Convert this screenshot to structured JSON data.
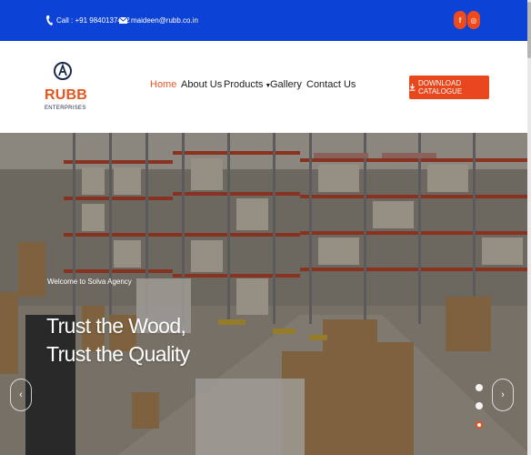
{
  "topbar": {
    "phone": "Call : +91 9840137482",
    "email": "maideen@rubb.co.in",
    "social": [
      {
        "name": "facebook-icon",
        "glyph": "f"
      },
      {
        "name": "instagram-icon",
        "glyph": "◎"
      }
    ]
  },
  "header": {
    "logo": {
      "word": "RUBB",
      "sub": "ENTERPRISES"
    },
    "nav": [
      {
        "label": "Home",
        "active": true
      },
      {
        "label": "About Us"
      },
      {
        "label": "Products"
      },
      {
        "label": "Gallery"
      },
      {
        "label": "Contact Us"
      }
    ],
    "products_caret": "▼",
    "cta": "DOWNLOAD CATALOGUE"
  },
  "hero": {
    "eyebrow": "Welcome to Solva Agency",
    "headline_line1": "Trust the Wood,",
    "headline_line2": "Trust the Quality",
    "prev_glyph": "‹",
    "next_glyph": "›",
    "active_slide": 3,
    "slide_count": 3
  },
  "colors": {
    "topbar": "#0c43d6",
    "accent": "#e8461c",
    "nav_active": "#e9572a"
  }
}
